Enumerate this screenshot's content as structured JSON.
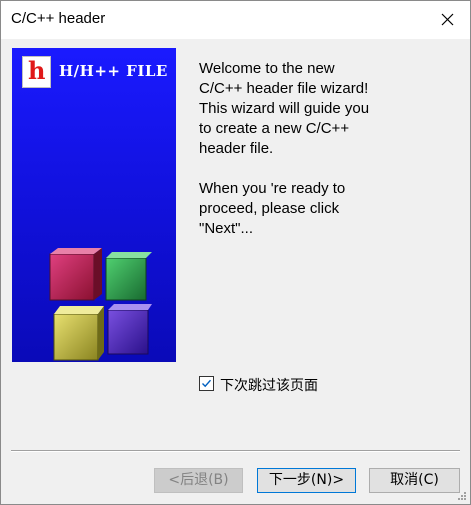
{
  "window": {
    "title": "C/C++ header",
    "close_symbol": "close-icon"
  },
  "banner": {
    "logo_letter": "h",
    "text": "H/H++ FILE"
  },
  "content": {
    "welcome_text": "Welcome to the new\nC/C++ header file wizard!\nThis wizard will guide you\nto create a new C/C++\nheader file.\n\nWhen you 're ready to\nproceed, please click\n\"Next\"..."
  },
  "skip": {
    "label": "下次跳过该页面",
    "checked": true
  },
  "buttons": {
    "back": "<后退(B)",
    "next": "下一步(N)>",
    "cancel": "取消(C)"
  },
  "colors": {
    "banner_blue": "#1414f0",
    "focus_border": "#0078d7",
    "check_color": "#0060c0"
  }
}
